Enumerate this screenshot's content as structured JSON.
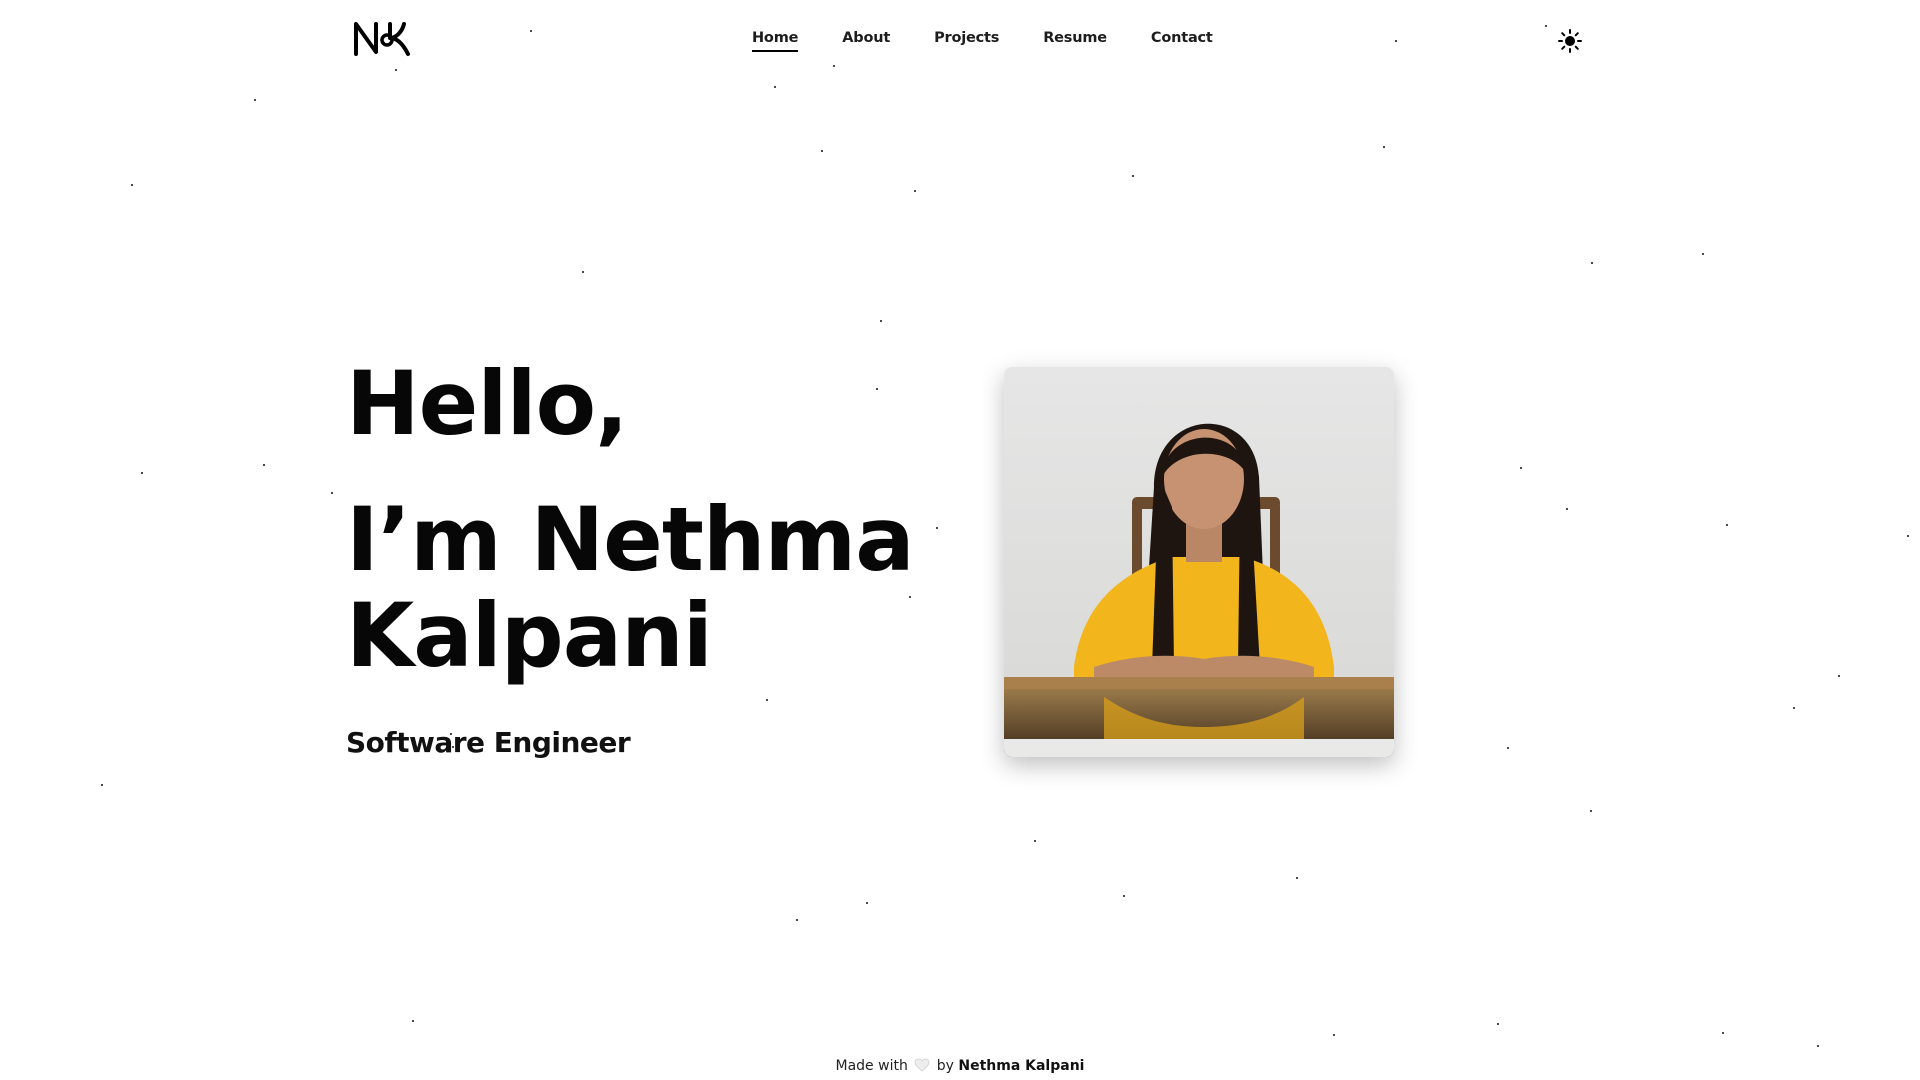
{
  "brand": {
    "logo_text": "NK"
  },
  "nav": {
    "items": [
      {
        "label": "Home",
        "active": true
      },
      {
        "label": "About",
        "active": false
      },
      {
        "label": "Projects",
        "active": false
      },
      {
        "label": "Resume",
        "active": false
      },
      {
        "label": "Contact",
        "active": false
      }
    ],
    "theme_toggle_icon": "sun-icon"
  },
  "hero": {
    "greeting": "Hello,",
    "name": "I’m Nethma Kalpani",
    "role": "Software Engineer"
  },
  "photo": {
    "subject": "portrait-photo"
  },
  "footer": {
    "prefix": "Made with",
    "heart_icon": "heart-icon",
    "by": "by",
    "author": "Nethma Kalpani"
  },
  "colors": {
    "text": "#000000",
    "background": "#ffffff",
    "shirt": "#f2b51c"
  }
}
